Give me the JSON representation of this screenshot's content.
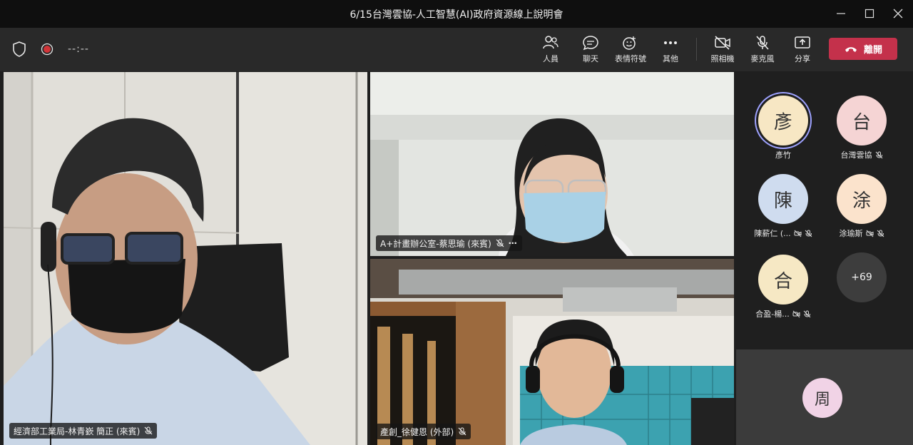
{
  "window": {
    "title": "6/15台灣雲協-人工智慧(AI)政府資源線上說明會"
  },
  "toolbar": {
    "timer": "--:--",
    "buttons": [
      {
        "label": "人員",
        "icon": "people-icon"
      },
      {
        "label": "聊天",
        "icon": "chat-icon"
      },
      {
        "label": "表情符號",
        "icon": "emoji-icon"
      },
      {
        "label": "其他",
        "icon": "more-icon"
      },
      {
        "label": "照相機",
        "icon": "camera-off-icon"
      },
      {
        "label": "麥克風",
        "icon": "mic-off-icon"
      },
      {
        "label": "分享",
        "icon": "share-icon"
      }
    ],
    "leave_label": "離開"
  },
  "tiles": [
    {
      "name": "經濟部工業局-林青嶔 簡正 (來賓)"
    },
    {
      "name": "A+計畫辦公室-蔡思瑜 (來賓)"
    },
    {
      "name": "產創_徐健恩 (外部)"
    }
  ],
  "roster": [
    {
      "initial": "彥",
      "name": "彥竹",
      "color": "#f7e7c4",
      "ring": true
    },
    {
      "initial": "台",
      "name": "台灣雲協",
      "color": "#f5d4d4",
      "muted": true
    },
    {
      "initial": "陳",
      "name": "陳薪仁 (...",
      "color": "#cfdcef",
      "muted": true
    },
    {
      "initial": "涂",
      "name": "涂瑜斯",
      "color": "#fbe3cc",
      "muted": true
    },
    {
      "initial": "合",
      "name": "合盈-楊...",
      "color": "#f6e8c4",
      "muted": true
    }
  ],
  "overflow_count": "+69",
  "self": {
    "initial": "周",
    "color": "#f1d3e6"
  },
  "colors": {
    "accent": "#6264a7",
    "leave": "#c4314b"
  }
}
